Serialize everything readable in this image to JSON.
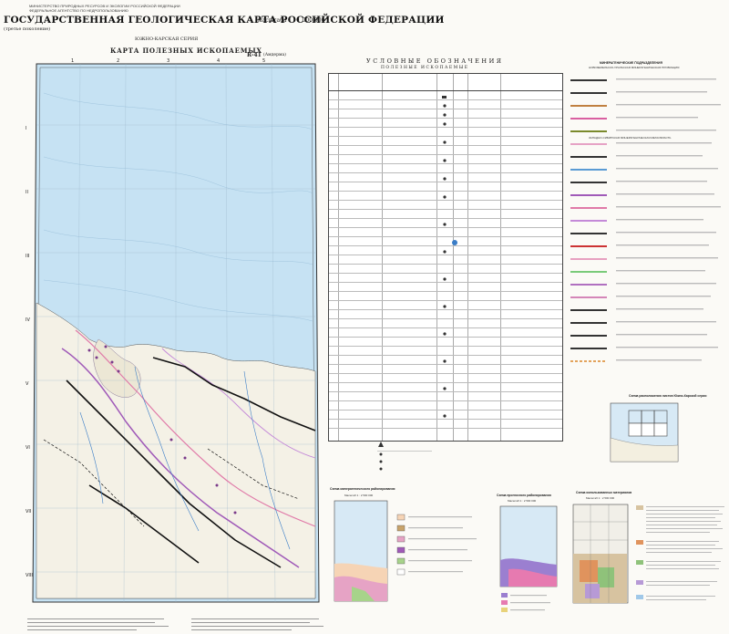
{
  "header": {
    "ministry": "МИНИСТЕРСТВО ПРИРОДНЫХ РЕСУРСОВ И ЭКОЛОГИИ РОССИЙСКОЙ ФЕДЕРАЦИИ",
    "agency": "ФЕДЕРАЛЬНОЕ АГЕНТСТВО ПО НЕДРОПОЛЬЗОВАНИЮ",
    "title": "ГОСУДАРСТВЕННАЯ ГЕОЛОГИЧЕСКАЯ КАРТА РОССИЙСКОЙ ФЕДЕРАЦИИ",
    "scale": "масштаба 1 : 1 000 000",
    "generation": "(третье поколение)",
    "series": "ЮЖНО-КАРСКАЯ СЕРИЯ",
    "map_title": "КАРТА ПОЛЕЗНЫХ ИСКОПАЕМЫХ",
    "sheet": "R-41",
    "sheet_name": "(Амдерма)"
  },
  "legend": {
    "head": "УСЛОВНЫЕ ОБОЗНАЧЕНИЯ",
    "subhead": "ПОЛЕЗНЫЕ ИСКОПАЕМЫЕ"
  },
  "mineragenic": {
    "head": "МИНЕРАГЕНИЧЕСКИЕ ПОДРАЗДЕЛЕНИЯ",
    "sub1": "НОВОЗЕМЕЛЬСКО-УРАЛЬСКАЯ МИНЕРАГЕНИЧЕСКАЯ ПРОВИНЦИЯ",
    "sub2": "ЗАПАДНО-СИБИРСКАЯ МИНЕРАГЕНИЧЕСКАЯ МЕГАОБЛАСТЬ"
  },
  "insets": {
    "scheme1": "Схема минерагенического районирования",
    "scheme1_scale": "Масштаб 1 : 2 500 000",
    "scheme2": "Схема прогнозного районирования",
    "scheme2_scale": "Масштаб 1 : 2 500 000",
    "scheme3": "Схема использованных материалов",
    "scheme3_scale": "Масштаб 1 : 2 500 000",
    "location": "Схема расположения листов Южно-Карской серии"
  },
  "colors": {
    "sea": "#c6e2f3",
    "land": "#f4f1e6",
    "fault": "#111111",
    "zone_purple": "#a05ab8",
    "zone_pink": "#e07aa8"
  }
}
